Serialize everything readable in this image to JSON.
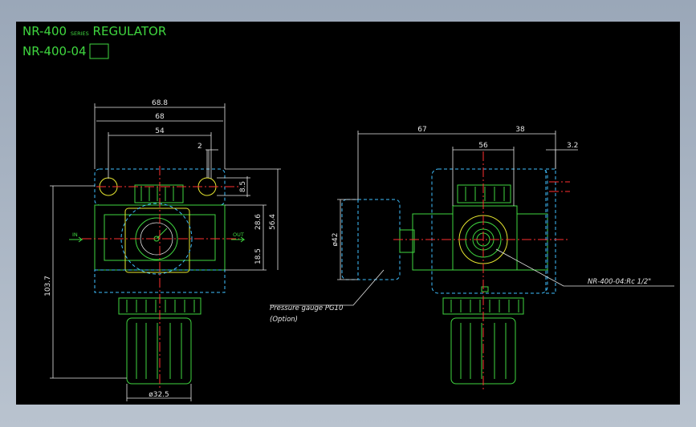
{
  "title": {
    "line1_main": "NR-400",
    "line1_series": "SERIES",
    "line1_rest": "REGULATOR",
    "line2_prefix": "NR-400-",
    "line2_boxed": "04"
  },
  "dimensions": {
    "front": [
      "68.8",
      "68",
      "54",
      "2",
      "8.5",
      "28.6",
      "56.4",
      "18.5",
      "103.7",
      "ø32.5"
    ],
    "side": [
      "67",
      "38",
      "56",
      "3.2",
      "ø42"
    ]
  },
  "ports": {
    "in": "IN",
    "out": "OUT"
  },
  "callouts": {
    "gauge_line1": "Pressure gauge PG10",
    "gauge_line2": "(Option)",
    "port": "NR-400-04:Rc 1/2\""
  },
  "colors": {
    "background": "#000000",
    "outline": "#3fd63f",
    "inner": "#e6e630",
    "hidden": "#3fbfff",
    "centerline": "#ff3030",
    "dimension": "#e6e6e6"
  }
}
